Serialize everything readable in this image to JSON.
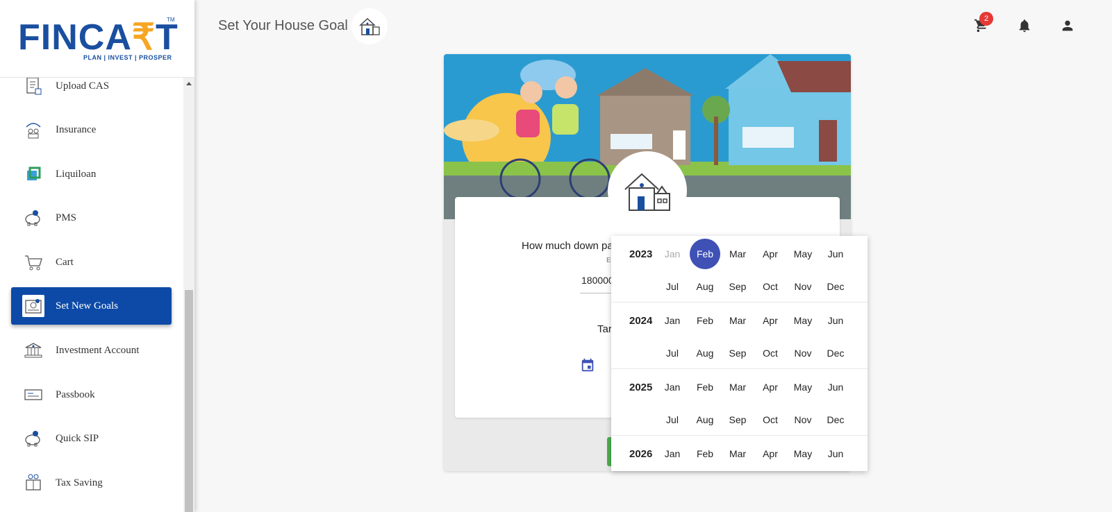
{
  "brand": {
    "logo_pre": "FINCA",
    "logo_rupee": "₹",
    "logo_post": "T",
    "tm": "TM",
    "tagline": "PLAN | INVEST | PROSPER",
    "color": "#1a4fa0",
    "accent": "#f5a623"
  },
  "sidebar": {
    "items": [
      {
        "label": "Upload CAS",
        "icon": "upload-cas-icon"
      },
      {
        "label": "Insurance",
        "icon": "insurance-icon"
      },
      {
        "label": "Liquiloan",
        "icon": "liquiloan-icon"
      },
      {
        "label": "PMS",
        "icon": "pms-icon"
      },
      {
        "label": "Cart",
        "icon": "cart-icon"
      },
      {
        "label": "Set New Goals",
        "icon": "goals-icon",
        "active": true
      },
      {
        "label": "Investment Account",
        "icon": "bank-icon"
      },
      {
        "label": "Passbook",
        "icon": "passbook-icon"
      },
      {
        "label": "Quick SIP",
        "icon": "quick-sip-icon"
      },
      {
        "label": "Tax Saving",
        "icon": "tax-saving-icon"
      }
    ],
    "active_color": "#0d4aa8"
  },
  "header": {
    "title": "Set Your House Goal",
    "cart_badge": "2"
  },
  "form": {
    "question": "How much down payment",
    "hint": "Enter",
    "amount": "1800000",
    "target_label": "Target"
  },
  "picker": {
    "selected_color": "#3f51b5",
    "years": [
      {
        "year": "2023",
        "months": [
          "Jan",
          "Feb",
          "Mar",
          "Apr",
          "May",
          "Jun",
          "Jul",
          "Aug",
          "Sep",
          "Oct",
          "Nov",
          "Dec"
        ]
      },
      {
        "year": "2024",
        "months": [
          "Jan",
          "Feb",
          "Mar",
          "Apr",
          "May",
          "Jun",
          "Jul",
          "Aug",
          "Sep",
          "Oct",
          "Nov",
          "Dec"
        ]
      },
      {
        "year": "2025",
        "months": [
          "Jan",
          "Feb",
          "Mar",
          "Apr",
          "May",
          "Jun",
          "Jul",
          "Aug",
          "Sep",
          "Oct",
          "Nov",
          "Dec"
        ]
      },
      {
        "year": "2026",
        "months": [
          "Jan",
          "Feb",
          "Mar",
          "Apr",
          "May",
          "Jun"
        ]
      }
    ],
    "selected": "2023-Feb",
    "disabled": [
      "2023-Jan"
    ]
  }
}
